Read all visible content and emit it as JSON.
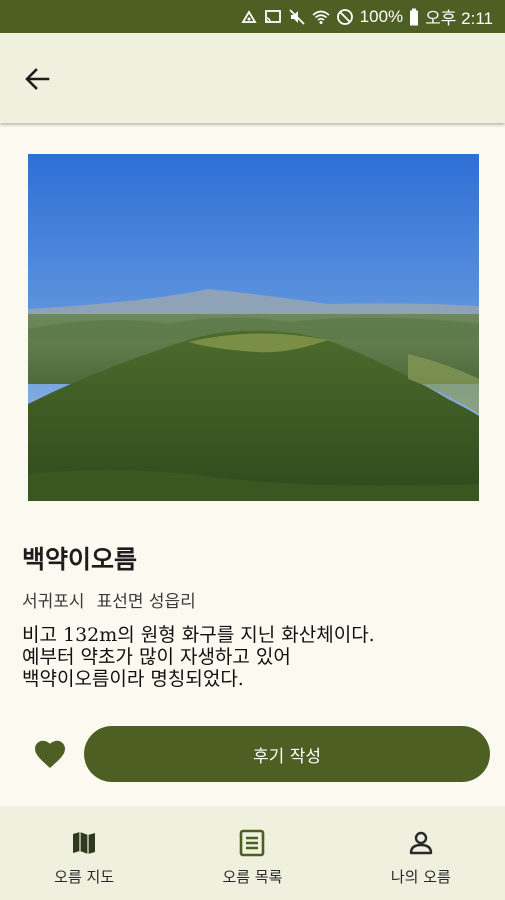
{
  "status_bar": {
    "battery": "100%",
    "time": "오후 2:11",
    "icons": [
      "android-debug-icon",
      "cast-icon",
      "mute-icon",
      "wifi-icon",
      "do-not-disturb-icon",
      "battery-icon"
    ]
  },
  "app_bar": {
    "back_icon": "arrow-left-icon"
  },
  "oreum": {
    "image_alt": "백약이오름",
    "name": "백약이오름",
    "location_city": "서귀포시",
    "location_detail": "표선면 성읍리",
    "description_lines": [
      "비고 132m의 원형 화구를 지닌 화산체이다.",
      "예부터 약초가 많이 자생하고 있어",
      "백약이오름이라 명칭되었다."
    ]
  },
  "actions": {
    "favorite_icon": "heart-icon",
    "review_label": "후기 작성"
  },
  "bottom_nav": {
    "items": [
      {
        "label": "오름 지도",
        "icon": "map-icon"
      },
      {
        "label": "오름 목록",
        "icon": "list-icon"
      },
      {
        "label": "나의 오름",
        "icon": "person-icon"
      }
    ]
  },
  "colors": {
    "primary": "#4e5f23",
    "surface": "#eff0de",
    "background": "#fcfaf0"
  }
}
